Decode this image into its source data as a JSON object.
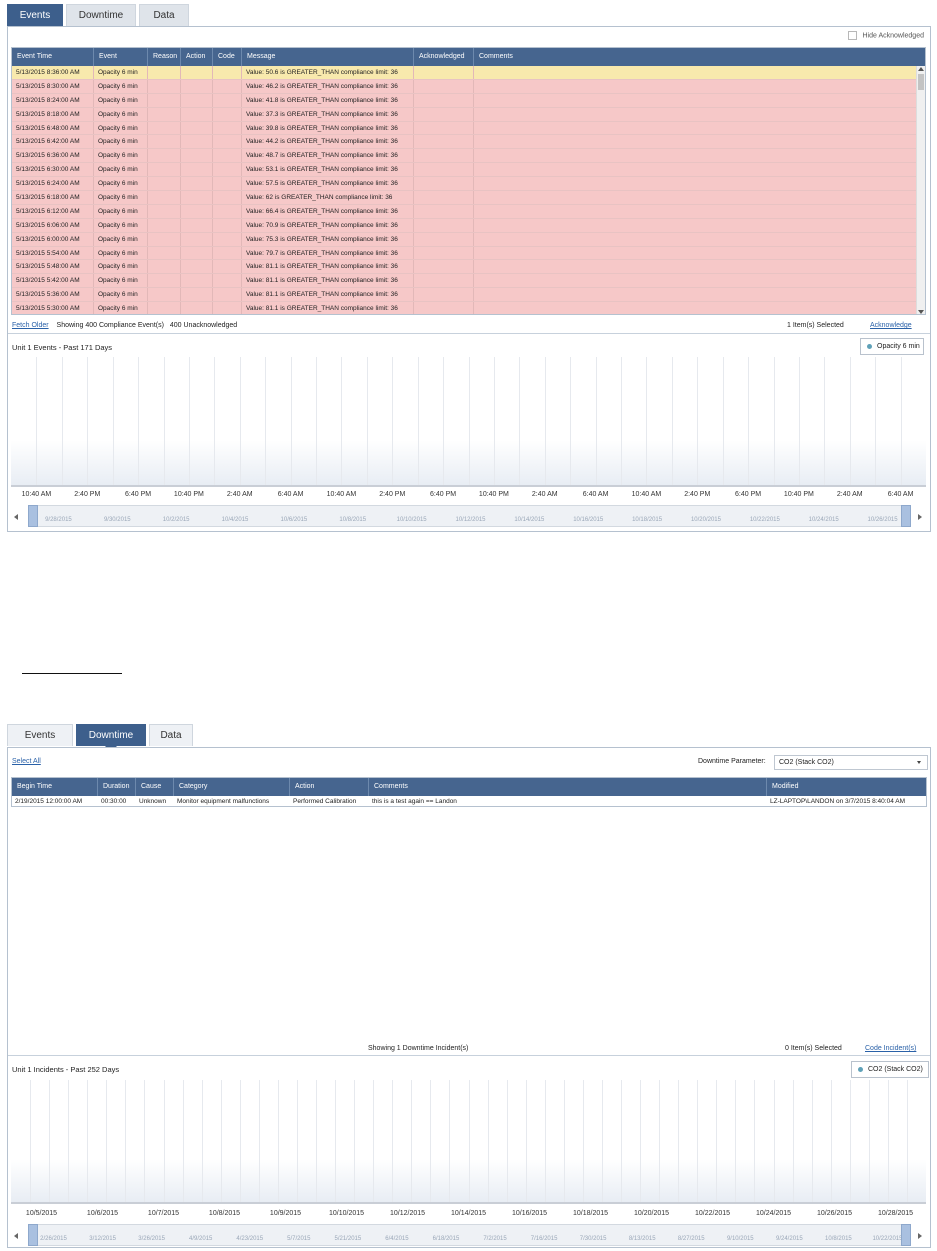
{
  "events_view": {
    "tabs": [
      "Events",
      "Downtime",
      "Data"
    ],
    "hide_acknowledged_label": "Hide Acknowledged",
    "columns": [
      "Event Time",
      "Event",
      "Reason",
      "Action",
      "Code",
      "Message",
      "Acknowledged",
      "Comments"
    ],
    "rows": [
      {
        "time": "5/13/2015 8:36:00 AM",
        "event": "Opacity 6 min",
        "message": "Value: 50.6 is GREATER_THAN compliance limit: 36",
        "state": "selected"
      },
      {
        "time": "5/13/2015 8:30:00 AM",
        "event": "Opacity 6 min",
        "message": "Value: 46.2 is GREATER_THAN compliance limit: 36",
        "state": "alert"
      },
      {
        "time": "5/13/2015 8:24:00 AM",
        "event": "Opacity 6 min",
        "message": "Value: 41.8 is GREATER_THAN compliance limit: 36",
        "state": "alert"
      },
      {
        "time": "5/13/2015 8:18:00 AM",
        "event": "Opacity 6 min",
        "message": "Value: 37.3 is GREATER_THAN compliance limit: 36",
        "state": "alert"
      },
      {
        "time": "5/13/2015 6:48:00 AM",
        "event": "Opacity 6 min",
        "message": "Value: 39.8 is GREATER_THAN compliance limit: 36",
        "state": "alert"
      },
      {
        "time": "5/13/2015 6:42:00 AM",
        "event": "Opacity 6 min",
        "message": "Value: 44.2 is GREATER_THAN compliance limit: 36",
        "state": "alert"
      },
      {
        "time": "5/13/2015 6:36:00 AM",
        "event": "Opacity 6 min",
        "message": "Value: 48.7 is GREATER_THAN compliance limit: 36",
        "state": "alert"
      },
      {
        "time": "5/13/2015 6:30:00 AM",
        "event": "Opacity 6 min",
        "message": "Value: 53.1 is GREATER_THAN compliance limit: 36",
        "state": "alert"
      },
      {
        "time": "5/13/2015 6:24:00 AM",
        "event": "Opacity 6 min",
        "message": "Value: 57.5 is GREATER_THAN compliance limit: 36",
        "state": "alert"
      },
      {
        "time": "5/13/2015 6:18:00 AM",
        "event": "Opacity 6 min",
        "message": "Value: 62 is GREATER_THAN compliance limit: 36",
        "state": "alert"
      },
      {
        "time": "5/13/2015 6:12:00 AM",
        "event": "Opacity 6 min",
        "message": "Value: 66.4 is GREATER_THAN compliance limit: 36",
        "state": "alert"
      },
      {
        "time": "5/13/2015 6:06:00 AM",
        "event": "Opacity 6 min",
        "message": "Value: 70.9 is GREATER_THAN compliance limit: 36",
        "state": "alert"
      },
      {
        "time": "5/13/2015 6:00:00 AM",
        "event": "Opacity 6 min",
        "message": "Value: 75.3 is GREATER_THAN compliance limit: 36",
        "state": "alert"
      },
      {
        "time": "5/13/2015 5:54:00 AM",
        "event": "Opacity 6 min",
        "message": "Value: 79.7 is GREATER_THAN compliance limit: 36",
        "state": "alert"
      },
      {
        "time": "5/13/2015 5:48:00 AM",
        "event": "Opacity 6 min",
        "message": "Value: 81.1 is GREATER_THAN compliance limit: 36",
        "state": "alert"
      },
      {
        "time": "5/13/2015 5:42:00 AM",
        "event": "Opacity 6 min",
        "message": "Value: 81.1 is GREATER_THAN compliance limit: 36",
        "state": "alert"
      },
      {
        "time": "5/13/2015 5:36:00 AM",
        "event": "Opacity 6 min",
        "message": "Value: 81.1 is GREATER_THAN compliance limit: 36",
        "state": "alert"
      },
      {
        "time": "5/13/2015 5:30:00 AM",
        "event": "Opacity 6 min",
        "message": "Value: 81.1 is GREATER_THAN compliance limit: 36",
        "state": "alert"
      }
    ],
    "footer": {
      "fetch_older": "Fetch Older",
      "showing": "Showing 400 Compliance Event(s)",
      "unacknowledged": "400 Unacknowledged",
      "selected": "1 Item(s) Selected",
      "acknowledge": "Acknowledge"
    },
    "timeline": {
      "title": "Unit 1 Events - Past 171 Days",
      "legend": "Opacity 6 min",
      "axis_labels": [
        "10:40 AM",
        "2:40 PM",
        "6:40 PM",
        "10:40 PM",
        "2:40 AM",
        "6:40 AM",
        "10:40 AM",
        "2:40 PM",
        "6:40 PM",
        "10:40 PM",
        "2:40 AM",
        "6:40 AM",
        "10:40 AM",
        "2:40 PM",
        "6:40 PM",
        "10:40 PM",
        "2:40 AM",
        "6:40 AM"
      ],
      "nav_labels": [
        "9/28/2015",
        "9/30/2015",
        "10/2/2015",
        "10/4/2015",
        "10/6/2015",
        "10/8/2015",
        "10/10/2015",
        "10/12/2015",
        "10/14/2015",
        "10/16/2015",
        "10/18/2015",
        "10/20/2015",
        "10/22/2015",
        "10/24/2015",
        "10/26/2015"
      ]
    }
  },
  "downtime_view": {
    "tabs": [
      "Events",
      "Downtime",
      "Data"
    ],
    "select_all": "Select All",
    "param_label": "Downtime Parameter:",
    "param_value": "CO2 (Stack CO2)",
    "columns": [
      "Begin Time",
      "Duration",
      "Cause",
      "Category",
      "Action",
      "Comments",
      "Modified"
    ],
    "rows": [
      {
        "begin": "2/19/2015 12:00:00 AM",
        "duration": "00:30:00",
        "cause": "Unknown",
        "category": "Monitor equipment malfunctions",
        "action": "Performed Calibration",
        "comments": "this is a test  again == Landon",
        "modified": "LZ-LAPTOP\\LANDON on 3/7/2015 8:40:04 AM"
      }
    ],
    "footer": {
      "showing": "Showing 1 Downtime Incident(s)",
      "selected": "0 Item(s) Selected",
      "code": "Code Incident(s)"
    },
    "timeline": {
      "title": "Unit 1 Incidents - Past 252 Days",
      "legend": "CO2 (Stack CO2)",
      "axis_labels": [
        "10/5/2015",
        "10/6/2015",
        "10/7/2015",
        "10/8/2015",
        "10/9/2015",
        "10/10/2015",
        "10/12/2015",
        "10/14/2015",
        "10/16/2015",
        "10/18/2015",
        "10/20/2015",
        "10/22/2015",
        "10/24/2015",
        "10/26/2015",
        "10/28/2015"
      ],
      "nav_labels": [
        "2/26/2015",
        "3/12/2015",
        "3/26/2015",
        "4/9/2015",
        "4/23/2015",
        "5/7/2015",
        "5/21/2015",
        "6/4/2015",
        "6/18/2015",
        "7/2/2015",
        "7/16/2015",
        "7/30/2015",
        "8/13/2015",
        "8/27/2015",
        "9/10/2015",
        "9/24/2015",
        "10/8/2015",
        "10/22/2015"
      ]
    }
  },
  "colors": {
    "header": "#46658f",
    "alert_row": "#f6c8c8",
    "selected_row": "#f8e9ad",
    "legend_dot": "#5fa1b8"
  }
}
